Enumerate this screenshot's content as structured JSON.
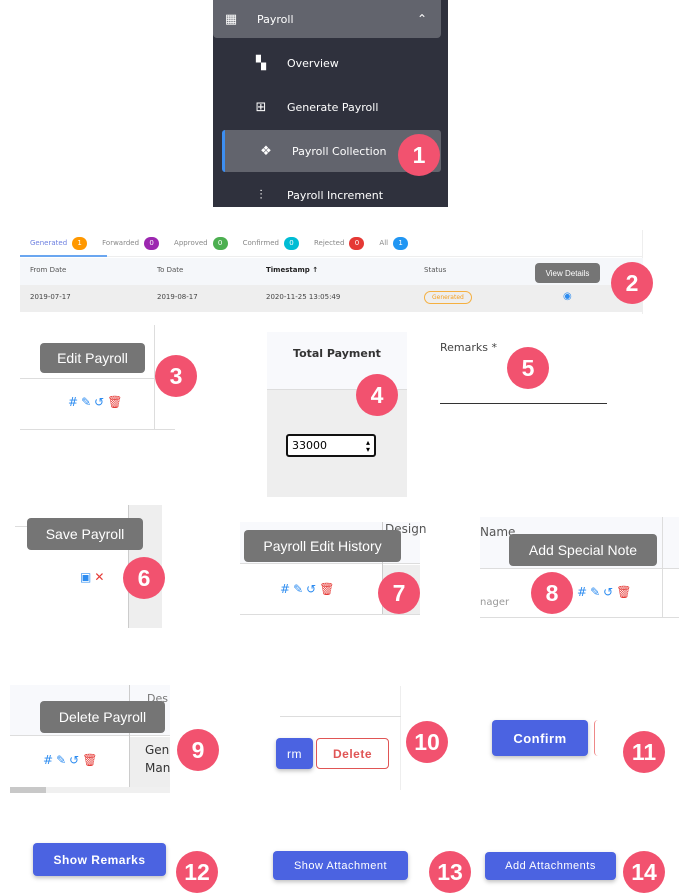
{
  "sidebar": {
    "group": "Payroll",
    "items": [
      {
        "label": "Overview",
        "icon": "grid-icon"
      },
      {
        "label": "Generate Payroll",
        "icon": "calculator-icon"
      },
      {
        "label": "Payroll Collection",
        "icon": "diamonds-icon",
        "active": true
      },
      {
        "label": "Payroll Increment",
        "icon": "chart-icon"
      }
    ]
  },
  "tabs": [
    {
      "label": "Generated",
      "count": "1",
      "color": "#ff9800"
    },
    {
      "label": "Forwarded",
      "count": "0",
      "color": "#9c27b0"
    },
    {
      "label": "Approved",
      "count": "0",
      "color": "#4caf50"
    },
    {
      "label": "Confirmed",
      "count": "0",
      "color": "#00bcd4"
    },
    {
      "label": "Rejected",
      "count": "0",
      "color": "#e53935"
    },
    {
      "label": "All",
      "count": "1",
      "color": "#2196f3"
    }
  ],
  "table": {
    "headers": [
      "From Date",
      "To Date",
      "Timestamp ↑",
      "Status"
    ],
    "row": [
      "2019-07-17",
      "2019-08-17",
      "2020-11-25 13:05:49"
    ],
    "status": "Generated",
    "tooltip": "View Details"
  },
  "tooltips": {
    "edit": "Edit Payroll",
    "save": "Save Payroll",
    "history": "Payroll Edit History",
    "note": "Add Special Note",
    "delete": "Delete Payroll"
  },
  "total": {
    "header": "Total Payment",
    "value": "33000"
  },
  "remarks": {
    "label": "Remarks *"
  },
  "fragments": {
    "design": "Design",
    "name": "Name",
    "manager": "nager",
    "gen": "Gen",
    "man": "Man",
    "des": "Des"
  },
  "buttons": {
    "confirm_partial": "rm",
    "delete": "Delete",
    "confirm": "Confirm",
    "show_remarks": "Show Remarks",
    "show_attachment": "Show Attachment",
    "add_attachments": "Add Attachments"
  },
  "badges": [
    "1",
    "2",
    "3",
    "4",
    "5",
    "6",
    "7",
    "8",
    "9",
    "10",
    "11",
    "12",
    "13",
    "14"
  ]
}
